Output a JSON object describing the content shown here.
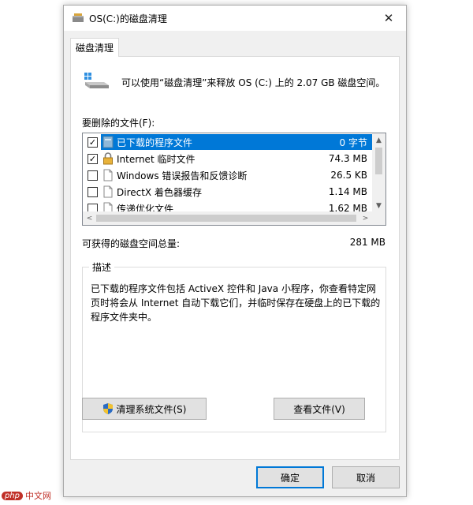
{
  "window": {
    "title": "OS(C:)的磁盘清理",
    "close_glyph": "✕"
  },
  "tab": {
    "label": "磁盘清理"
  },
  "summary": "可以使用“磁盘清理”来释放 OS (C:) 上的 2.07 GB 磁盘空间。",
  "files_label": "要删除的文件(F):",
  "files": [
    {
      "name": "已下载的程序文件",
      "size": "0 字节",
      "checked": true,
      "check_glyph": "✓",
      "selected": true
    },
    {
      "name": "Internet 临时文件",
      "size": "74.3 MB",
      "checked": true,
      "check_glyph": "✓",
      "selected": false
    },
    {
      "name": "Windows 错误报告和反馈诊断",
      "size": "26.5 KB",
      "checked": false,
      "check_glyph": "",
      "selected": false
    },
    {
      "name": "DirectX 着色器缓存",
      "size": "1.14 MB",
      "checked": false,
      "check_glyph": "",
      "selected": false
    },
    {
      "name": "传递优化文件",
      "size": "1.62 MB",
      "checked": false,
      "check_glyph": "",
      "selected": false
    }
  ],
  "scroll": {
    "up": "▲",
    "down": "▼",
    "left": "<",
    "right": ">"
  },
  "total": {
    "label": "可获得的磁盘空间总量:",
    "value": "281 MB"
  },
  "description": {
    "title": "描述",
    "text": "已下载的程序文件包括 ActiveX 控件和 Java 小程序，你查看特定网页时将会从 Internet 自动下载它们，并临时保存在硬盘上的已下载的程序文件夹中。"
  },
  "buttons": {
    "cleanup_system": "清理系统文件(S)",
    "view_files": "查看文件(V)",
    "ok": "确定",
    "cancel": "取消"
  },
  "watermark": {
    "badge": "php",
    "text": "中文网"
  },
  "colors": {
    "accent": "#0078d7",
    "window_bg": "#f0f0f0",
    "button_bg": "#e1e1e1"
  }
}
